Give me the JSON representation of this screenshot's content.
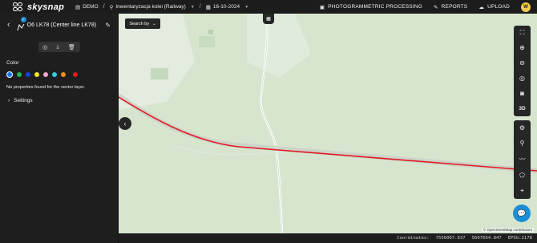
{
  "brand": {
    "name": "skysnap"
  },
  "breadcrumb": {
    "project": "DEMO",
    "mission": "Inwentaryzacja kolei (Railway)",
    "date": "16-10-2024"
  },
  "header_actions": {
    "photogrammetric": "PHOTOGRAMMETRIC PROCESSING",
    "reports": "REPORTS",
    "upload": "UPLOAD",
    "avatar_initial": "W"
  },
  "layer": {
    "title": "O6 LK78 (Center line LK78)",
    "color_label": "Color",
    "colors": [
      "#1a73e8",
      "#1db954",
      "#1a3fd6",
      "#f5e52a",
      "#f4a6c8",
      "#2fd1e3",
      "#f28c1e",
      "#e31b23"
    ],
    "selected_color_index": 0,
    "no_properties": "No properties found for the vector layer.",
    "settings_label": "Settings"
  },
  "map": {
    "search_by": "Search by",
    "attribution": "© OpenStreetMap contributors",
    "line_color": "#e31b23"
  },
  "status": {
    "coordinates_label": "Coordinates:",
    "x": "7556007.837",
    "y": "5607664.847",
    "epsg": "EPSG:2178"
  },
  "icons": {
    "toolbar_top": [
      "fullscreen-icon",
      "zoom-in-icon",
      "zoom-out-icon",
      "locate-icon",
      "camera-icon",
      "3d-icon"
    ],
    "toolbar_bottom": [
      "gear-icon",
      "marker-icon",
      "polyline-icon",
      "polygon-icon",
      "focus-icon"
    ]
  },
  "toolbar_3d_label": "3D"
}
